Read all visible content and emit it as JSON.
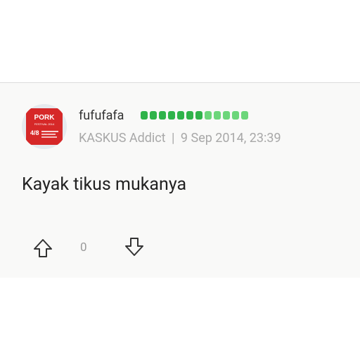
{
  "post": {
    "author": {
      "username": "fufufafa",
      "rank_title": "KASKUS Addict",
      "avatar_text": [
        "PORK",
        "FESTIVAL 2014",
        "4/8"
      ],
      "rank_bar": {
        "total": 12,
        "colors": [
          "#2fb34a",
          "#2fb34a",
          "#2fb34a",
          "#2fb34a",
          "#2fb34a",
          "#2fb34a",
          "#2fb34a",
          "#6cd67a",
          "#6cd67a",
          "#6cd67a",
          "#6cd67a",
          "#6cd67a"
        ]
      }
    },
    "separator": "|",
    "timestamp": "9 Sep 2014, 23:39",
    "content": "Kayak tikus mukanya",
    "vote_count": "0"
  },
  "icons": {
    "upvote": "arrow-up-icon",
    "downvote": "arrow-down-icon"
  }
}
